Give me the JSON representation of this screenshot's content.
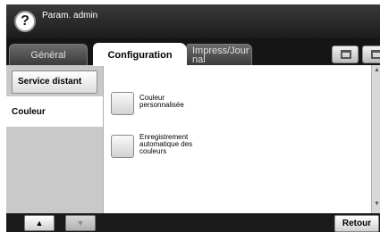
{
  "header": {
    "title": "Param. admin",
    "help_glyph": "?"
  },
  "tabs": [
    {
      "label": "Général",
      "active": false
    },
    {
      "label": "Configuration",
      "active": true
    },
    {
      "label": "Impress/Jour nal",
      "line1": "Impress/Jour",
      "line2": "nal",
      "active": false
    }
  ],
  "toolbar": {
    "icons": [
      "job-status-icon",
      "home-icon"
    ]
  },
  "sidebar": {
    "items": [
      {
        "label": "Service distant",
        "selected": false
      },
      {
        "label": "Couleur",
        "selected": true
      }
    ]
  },
  "main": {
    "options": [
      {
        "line1": "Couleur",
        "line2": "personnalisée"
      },
      {
        "line1": "Enregistrement",
        "line2": "automatique des",
        "line3": "couleurs"
      }
    ]
  },
  "footer": {
    "back_label": "Retour",
    "up_glyph": "▲",
    "down_glyph": "▼"
  },
  "colors": {
    "header": "#1a1a1a",
    "sidebar": "#c9c9c9",
    "active_tab": "#ffffff"
  }
}
